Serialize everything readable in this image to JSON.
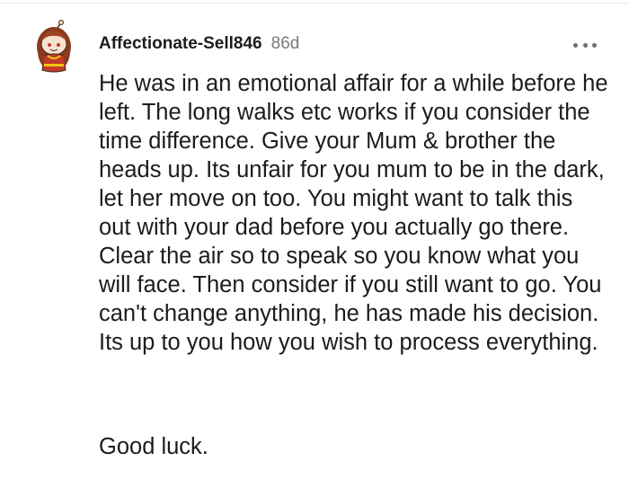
{
  "comment": {
    "author": "Affectionate-Sell846",
    "age": "86d",
    "avatar_icon": "snoo-avatar-icon",
    "more_icon": "more-options-icon",
    "body": "He was in an emotional affair for a while before he left. The long walks etc works if you consider the time difference. Give your Mum & brother the heads up. Its unfair for you mum to be in the dark, let her move on too. You might want to talk this out with your dad before you actually go there. Clear the air so to speak so you know what you will face. Then consider if you still want to go. You can't change anything, he has made his decision. Its up to you how you wish to process everything.",
    "signoff": "Good luck."
  },
  "colors": {
    "text": "#1c1c1c",
    "meta": "#7c7c7c",
    "divider": "#e9e9e9"
  }
}
